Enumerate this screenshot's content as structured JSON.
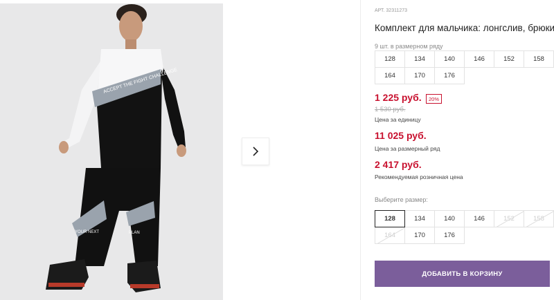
{
  "product": {
    "sku": "АРТ. 32311273",
    "title": "Комплект для мальчика: лонгслив, брюки",
    "pack_note": "9 шт. в размерном ряду",
    "pack_sizes": [
      "128",
      "134",
      "140",
      "146",
      "152",
      "158",
      "164",
      "170",
      "176"
    ],
    "price_unit": "1 225 руб.",
    "discount_badge": "20%",
    "old_price": "1 530 руб.",
    "price_unit_caption": "Цена за единицу",
    "price_pack": "11 025 руб.",
    "price_pack_caption": "Цена за размерный ряд",
    "price_rrp": "2 417 руб.",
    "price_rrp_caption": "Рекомендуемая розничная цена",
    "choose_label": "Выберите размер:",
    "sizes": [
      "128",
      "134",
      "140",
      "146",
      "152",
      "158",
      "164",
      "170",
      "176"
    ],
    "selected_size": "128",
    "unavailable_sizes": [
      "152",
      "158",
      "164"
    ],
    "add_to_cart": "ДОБАВИТЬ В КОРЗИНУ"
  },
  "gallery": {
    "shirt_print_text": "ACCEPT THE FIGHT CHALLENGE",
    "pants_print_left": "YOUR NEXT",
    "pants_print_right": "PLAN",
    "next_icon": "chevron-right-icon"
  },
  "colors": {
    "price_red": "#c8102e",
    "cta_purple": "#7b5e9b"
  }
}
